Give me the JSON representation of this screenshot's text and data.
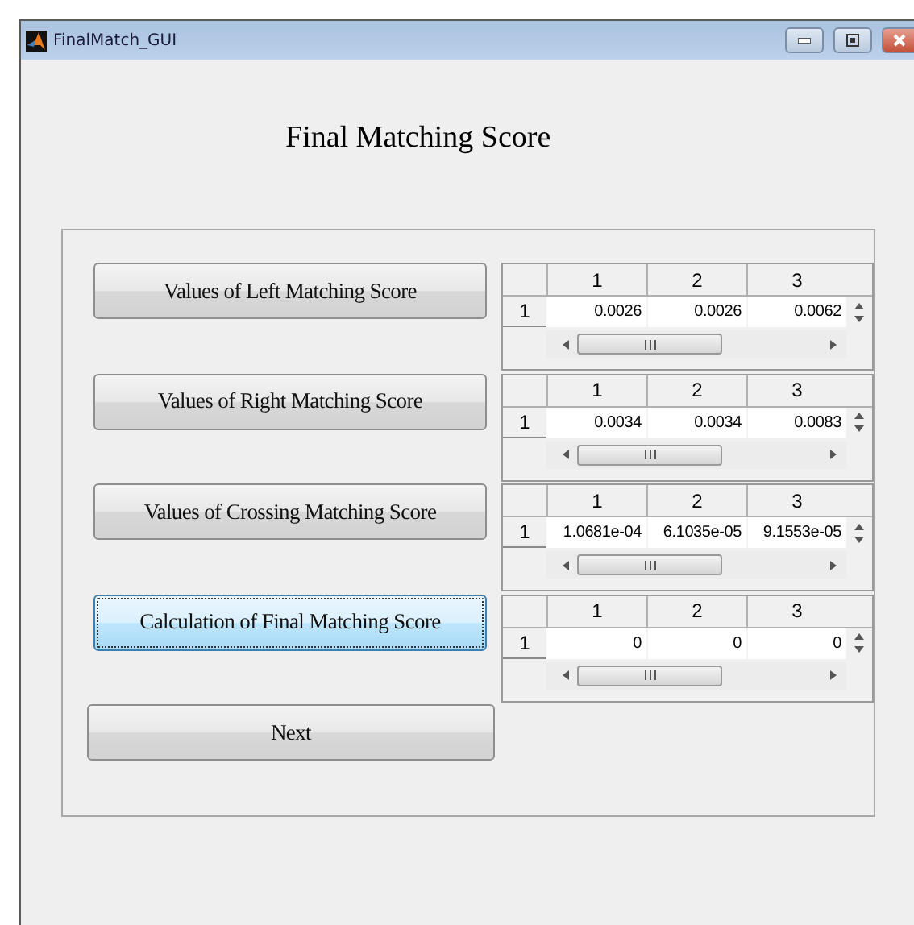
{
  "window": {
    "title": "FinalMatch_GUI"
  },
  "heading": "Final Matching Score",
  "rows": [
    {
      "button": {
        "label": "Values of Left Matching Score",
        "focused": false
      },
      "table": {
        "columns": [
          "1",
          "2",
          "3"
        ],
        "rows": [
          {
            "header": "1",
            "cells": [
              "0.0026",
              "0.0026",
              "0.0062"
            ]
          }
        ]
      }
    },
    {
      "button": {
        "label": "Values of Right Matching Score",
        "focused": false
      },
      "table": {
        "columns": [
          "1",
          "2",
          "3"
        ],
        "rows": [
          {
            "header": "1",
            "cells": [
              "0.0034",
              "0.0034",
              "0.0083"
            ]
          }
        ]
      }
    },
    {
      "button": {
        "label": "Values of Crossing Matching Score",
        "focused": false
      },
      "table": {
        "columns": [
          "1",
          "2",
          "3"
        ],
        "rows": [
          {
            "header": "1",
            "cells": [
              "1.0681e-04",
              "6.1035e-05",
              "9.1553e-05"
            ]
          }
        ]
      }
    },
    {
      "button": {
        "label": "Calculation of Final  Matching Score",
        "focused": true
      },
      "table": {
        "columns": [
          "1",
          "2",
          "3"
        ],
        "rows": [
          {
            "header": "1",
            "cells": [
              "0",
              "0",
              "0"
            ]
          }
        ]
      }
    },
    {
      "button": {
        "label": "Next",
        "focused": false
      }
    }
  ]
}
